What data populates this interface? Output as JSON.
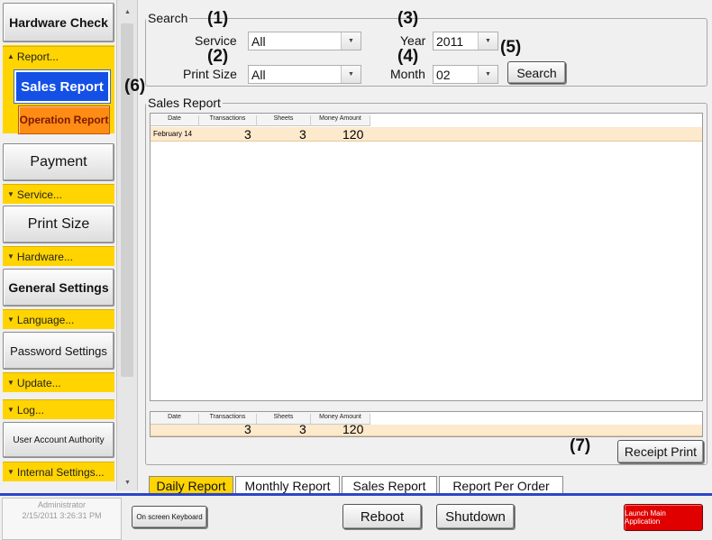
{
  "sidebar": {
    "hardware_check": "Hardware Check",
    "report_header": "Report...",
    "sales_report": "Sales Report",
    "operation_report": "Operation Report",
    "payment": "Payment",
    "service_header": "Service...",
    "print_size": "Print Size",
    "hardware_header": "Hardware...",
    "general_settings": "General Settings",
    "language_header": "Language...",
    "password_settings": "Password Settings",
    "update_header": "Update...",
    "log_header": "Log...",
    "user_account_authority": "User Account Authority",
    "internal_settings_header": "Internal Settings..."
  },
  "search": {
    "legend": "Search",
    "service_label": "Service",
    "service_value": "All",
    "print_size_label": "Print Size",
    "print_size_value": "All",
    "year_label": "Year",
    "year_value": "2011",
    "month_label": "Month",
    "month_value": "02",
    "search_button": "Search"
  },
  "callouts": {
    "c1": "(1)",
    "c2": "(2)",
    "c3": "(3)",
    "c4": "(4)",
    "c5": "(5)",
    "c6": "(6)",
    "c7": "(7)"
  },
  "sales_report": {
    "legend": "Sales Report",
    "columns": [
      "Date",
      "Transactions",
      "Sheets",
      "Money Amount"
    ],
    "rows": [
      {
        "date": "February 14",
        "transactions": "3",
        "sheets": "3",
        "money_amount": "120"
      }
    ],
    "totals": {
      "transactions": "3",
      "sheets": "3",
      "money_amount": "120"
    }
  },
  "receipt_print_button": "Receipt Print",
  "tabs": [
    {
      "label": "Daily Report",
      "active": true
    },
    {
      "label": "Monthly Report",
      "active": false
    },
    {
      "label": "Sales Report",
      "active": false
    },
    {
      "label": "Report Per Order",
      "active": false
    }
  ],
  "bottom": {
    "user": "Administrator",
    "datetime": "2/15/2011 3:26:31 PM",
    "on_screen_keyboard": "On screen Keyboard",
    "reboot": "Reboot",
    "shutdown": "Shutdown",
    "launch_main_application": "Launch Main Application"
  },
  "colors": {
    "accent_yellow": "#ffd400",
    "selected_blue": "#1450e6",
    "orange": "#ff8c14",
    "row_highlight": "#fde9cc",
    "launch_red": "#e00000",
    "separator_blue": "#2c45c8"
  },
  "icons": {
    "scroll_up": "triangle-up-icon",
    "scroll_down": "triangle-down-icon",
    "combo_drop": "triangle-down-icon",
    "section_expand": "chevron-down-icon"
  }
}
